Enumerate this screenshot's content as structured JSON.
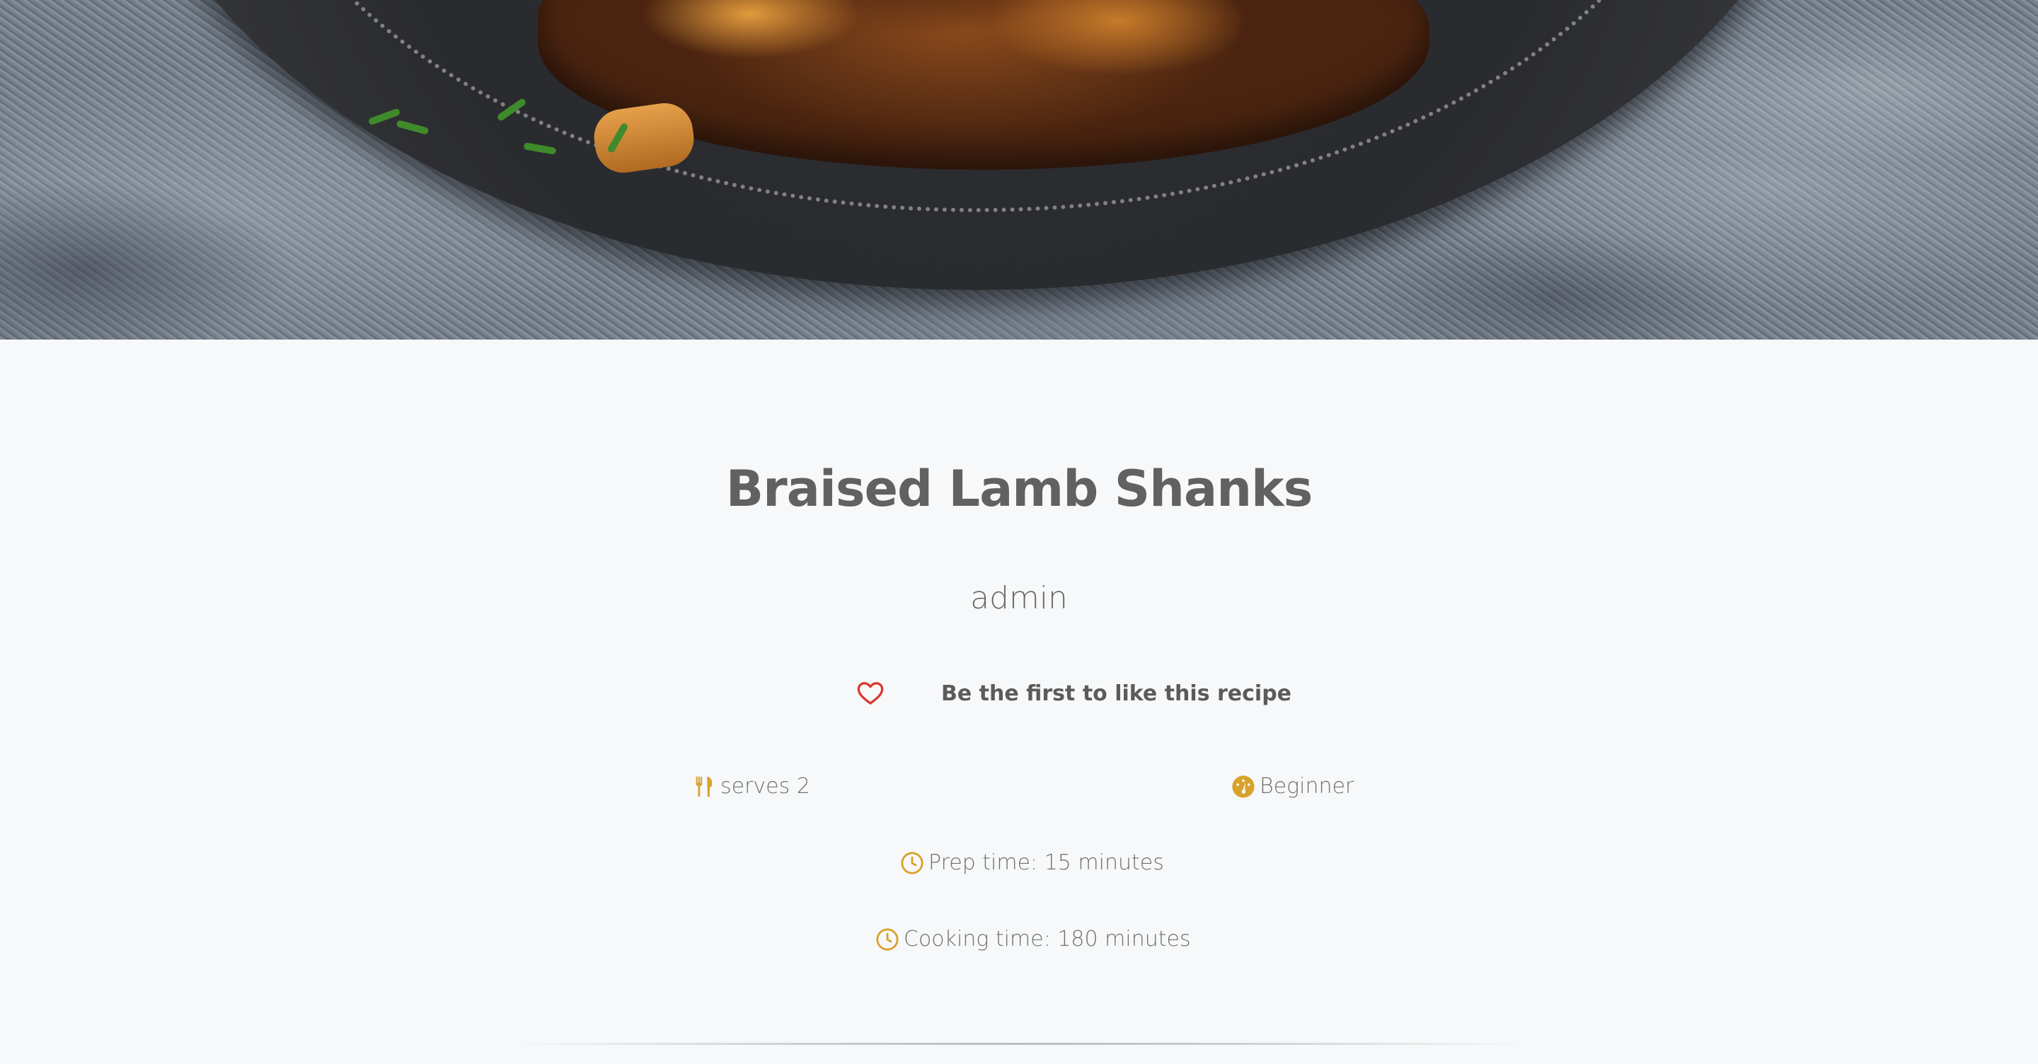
{
  "recipe": {
    "title": "Braised Lamb Shanks",
    "author": "admin",
    "like_text": "Be the first to like this recipe",
    "serves": "serves 2",
    "level": "Beginner",
    "prep_time": "Prep time: 15 minutes",
    "cooking_time": "Cooking time: 180 minutes"
  },
  "icons": {
    "like": "heart-icon",
    "serves": "fork-knife-icon",
    "level": "gauge-icon",
    "prep": "clock-icon",
    "cook": "clock-icon"
  },
  "colors": {
    "accent": "#d9a22a",
    "heart": "#d83a2e",
    "title": "#616161",
    "background": "#f7f8f9"
  }
}
